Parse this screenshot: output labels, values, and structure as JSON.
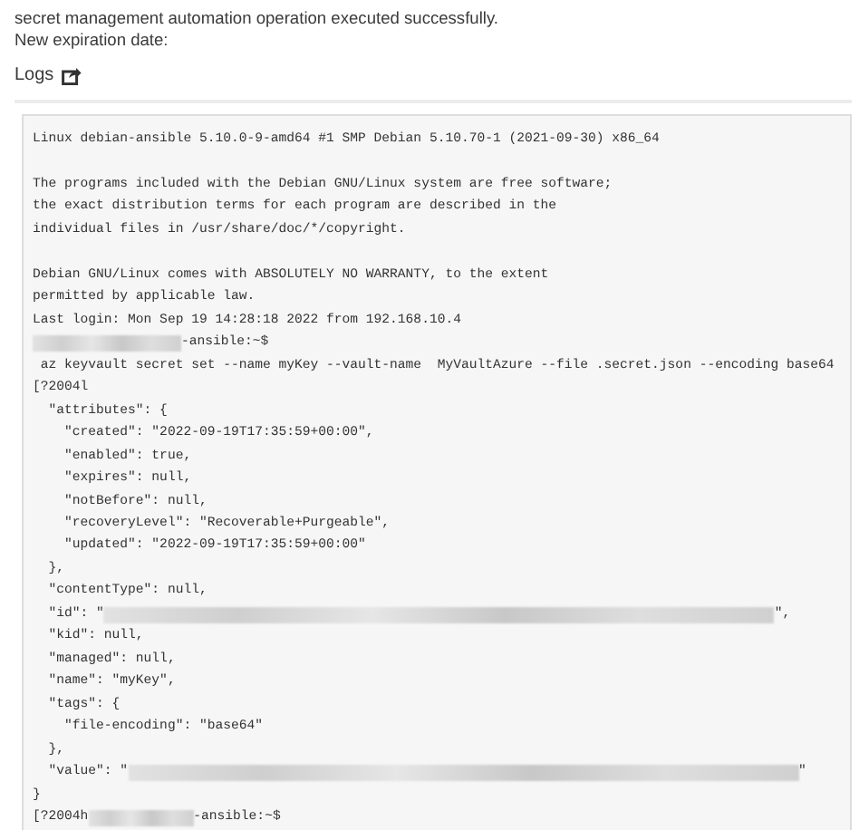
{
  "messages": [
    "secret management automation operation executed successfully.",
    "New expiration date:"
  ],
  "logs": {
    "title": "Logs",
    "lines": [
      [
        {
          "kind": "text",
          "text": "Linux debian-ansible 5.10.0-9-amd64 #1 SMP Debian 5.10.70-1 (2021-09-30) x86_64"
        }
      ],
      [
        {
          "kind": "blank"
        }
      ],
      [
        {
          "kind": "text",
          "text": "The programs included with the Debian GNU/Linux system are free software;"
        }
      ],
      [
        {
          "kind": "text",
          "text": "the exact distribution terms for each program are described in the"
        }
      ],
      [
        {
          "kind": "text",
          "text": "individual files in /usr/share/doc/*/copyright."
        }
      ],
      [
        {
          "kind": "blank"
        }
      ],
      [
        {
          "kind": "text",
          "text": "Debian GNU/Linux comes with ABSOLUTELY NO WARRANTY, to the extent"
        }
      ],
      [
        {
          "kind": "text",
          "text": "permitted by applicable law."
        }
      ],
      [
        {
          "kind": "text",
          "text": "Last login: Mon Sep 19 14:28:18 2022 from 192.168.10.4"
        }
      ],
      [
        {
          "kind": "redacted_short"
        },
        {
          "kind": "text",
          "text": "-ansible:~$"
        }
      ],
      [
        {
          "kind": "text",
          "text": " az keyvault secret set --name myKey --vault-name  MyVaultAzure --file .secret.json --encoding base64"
        }
      ],
      [
        {
          "kind": "text",
          "text": "[?2004l"
        }
      ],
      [
        {
          "kind": "text",
          "text": "  \"attributes\": {"
        }
      ],
      [
        {
          "kind": "text",
          "text": "    \"created\": \"2022-09-19T17:35:59+00:00\","
        }
      ],
      [
        {
          "kind": "text",
          "text": "    \"enabled\": true,"
        }
      ],
      [
        {
          "kind": "text",
          "text": "    \"expires\": null,"
        }
      ],
      [
        {
          "kind": "text",
          "text": "    \"notBefore\": null,"
        }
      ],
      [
        {
          "kind": "text",
          "text": "    \"recoveryLevel\": \"Recoverable+Purgeable\","
        }
      ],
      [
        {
          "kind": "text",
          "text": "    \"updated\": \"2022-09-19T17:35:59+00:00\""
        }
      ],
      [
        {
          "kind": "text",
          "text": "  },"
        }
      ],
      [
        {
          "kind": "text",
          "text": "  \"contentType\": null,"
        }
      ],
      [
        {
          "kind": "text",
          "text": "  \"id\": \""
        },
        {
          "kind": "redacted_long"
        },
        {
          "kind": "text",
          "text": "\","
        }
      ],
      [
        {
          "kind": "text",
          "text": "  \"kid\": null,"
        }
      ],
      [
        {
          "kind": "text",
          "text": "  \"managed\": null,"
        }
      ],
      [
        {
          "kind": "text",
          "text": "  \"name\": \"myKey\","
        }
      ],
      [
        {
          "kind": "text",
          "text": "  \"tags\": {"
        }
      ],
      [
        {
          "kind": "text",
          "text": "    \"file-encoding\": \"base64\""
        }
      ],
      [
        {
          "kind": "text",
          "text": "  },"
        }
      ],
      [
        {
          "kind": "text",
          "text": "  \"value\": \""
        },
        {
          "kind": "redacted_long"
        },
        {
          "kind": "text",
          "text": "\""
        }
      ],
      [
        {
          "kind": "text",
          "text": "}"
        }
      ],
      [
        {
          "kind": "text",
          "text": "[?2004h"
        },
        {
          "kind": "redacted_mid"
        },
        {
          "kind": "text",
          "text": "-ansible:~$"
        }
      ]
    ]
  }
}
